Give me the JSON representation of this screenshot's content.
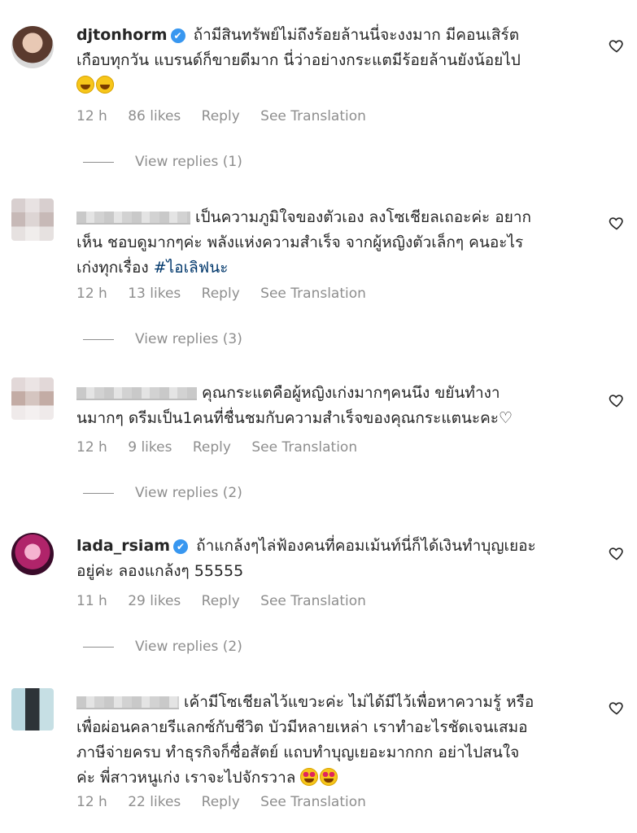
{
  "comments": [
    {
      "username": "djtonhorm",
      "verified": true,
      "text_line1": "ถ้ามีสินทรัพย์ไม่ถึงร้อยล้านนี่จะงงมาก มีคอนเสิร์ต",
      "text_line2": "เกือบทุกวัน แบรนด์ก็ขายดีมาก นี่ว่าอย่างกระแตมีร้อยล้านยังน้อยไป",
      "time": "12 h",
      "likes": "86 likes",
      "reply": "Reply",
      "translate": "See Translation",
      "view_replies": "View replies (1)"
    },
    {
      "username": "",
      "text_line1": "เป็นความภูมิใจของตัวเอง ลงโซเชียลเถอะค่ะ อยาก",
      "text_line2": "เห็น ชอบดูมากๆค่ะ พลังแห่งความสำเร็จ จากผู้หญิงตัวเล็กๆ คนอะไร",
      "text_line3": "เก่งทุกเรื่อง",
      "hashtag": "#ไอเลิฟนะ",
      "time": "12 h",
      "likes": "13 likes",
      "reply": "Reply",
      "translate": "See Translation",
      "view_replies": "View replies (3)"
    },
    {
      "username": "",
      "text_line1": "คุณกระแตคือผู้หญิงเก่งมากๆคนนึง ขยันทำงา",
      "text_line2": "นมากๆ ดรีมเป็น1คนที่ชื่นชมกับความสำเร็จของคุณกระแตนะคะ♡",
      "time": "12 h",
      "likes": "9 likes",
      "reply": "Reply",
      "translate": "See Translation",
      "view_replies": "View replies (2)"
    },
    {
      "username": "lada_rsiam",
      "verified": true,
      "text_line1": "ถ้าแกล้งๆไล่ฟ้องคนที่คอมเม้นท์นี่ก็ได้เงินทำบุญเยอะ",
      "text_line2": "อยู่ค่ะ ลองแกล้งๆ 55555",
      "time": "11 h",
      "likes": "29 likes",
      "reply": "Reply",
      "translate": "See Translation",
      "view_replies": "View replies (2)"
    },
    {
      "username": "",
      "text_line1": "เค้ามีโซเชียลไว้แขวะค่ะ ไม่ได้มีไว้เพื่อหาความรู้ หรือ",
      "text_line2": "เพื่อผ่อนคลายรีแลกซ์กับชีวิต บัวมีหลายเหล่า เราทำอะไรชัดเจนเสมอ",
      "text_line3": "ภาษีจ่ายครบ ทำธุรกิจก็ซื่อสัตย์ แถบทำบุญเยอะมากกก อย่าไปสนใจ",
      "text_line4": "ค่ะ พี่สาวหนูเก่ง เราจะไปจักรวาล",
      "time": "12 h",
      "likes": "22 likes",
      "reply": "Reply",
      "translate": "See Translation"
    }
  ],
  "icons": {
    "verified": "verified-badge-icon",
    "like": "heart-outline-icon",
    "emoji_laugh": "rolling-laughing-emoji",
    "emoji_heart_eyes": "heart-eyes-emoji"
  }
}
